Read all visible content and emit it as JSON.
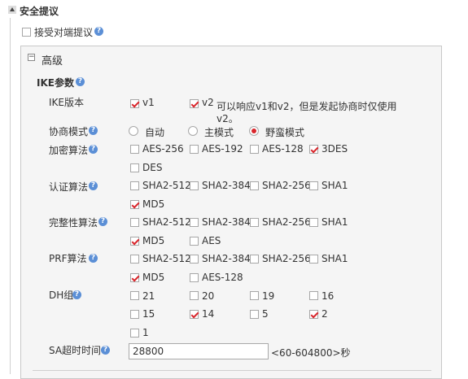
{
  "section": {
    "title": "安全提议"
  },
  "accept_peer": {
    "label": "接受对端提议",
    "checked": false
  },
  "advanced": {
    "title": "高级"
  },
  "ike": {
    "title": "IKE参数",
    "version": {
      "label": "IKE版本",
      "v1": "v1",
      "v2": "v2",
      "note_line1": "可以响应v1和v2，但是发起协商时仅使用",
      "note_line2": "v2。"
    },
    "mode": {
      "label": "协商模式",
      "options": [
        "自动",
        "主模式",
        "野蛮模式"
      ],
      "selected": "野蛮模式"
    },
    "encryption": {
      "label": "加密算法",
      "options": [
        "AES-256",
        "AES-192",
        "AES-128",
        "3DES",
        "DES"
      ],
      "checked": [
        "3DES"
      ]
    },
    "auth": {
      "label": "认证算法",
      "options": [
        "SHA2-512",
        "SHA2-384",
        "SHA2-256",
        "SHA1",
        "MD5"
      ],
      "checked": [
        "MD5"
      ]
    },
    "integrity": {
      "label": "完整性算法",
      "options": [
        "SHA2-512",
        "SHA2-384",
        "SHA2-256",
        "SHA1",
        "MD5",
        "AES"
      ],
      "checked": [
        "MD5"
      ]
    },
    "prf": {
      "label": "PRF算法",
      "options": [
        "SHA2-512",
        "SHA2-384",
        "SHA2-256",
        "SHA1",
        "MD5",
        "AES-128"
      ],
      "checked": [
        "MD5"
      ]
    },
    "dh": {
      "label": "DH组",
      "options": [
        "21",
        "20",
        "19",
        "16",
        "15",
        "14",
        "5",
        "2",
        "1"
      ],
      "checked": [
        "14",
        "2"
      ]
    },
    "sa_timeout": {
      "label": "SA超时时间",
      "value": "28800",
      "hint": "<60-604800>秒"
    }
  },
  "icons": {
    "section_toggle": "collapse-icon",
    "help": "question-icon"
  },
  "colors": {
    "check": "#d9262c",
    "help": "#5b8fd6",
    "panel_border": "#c8c8c8"
  }
}
